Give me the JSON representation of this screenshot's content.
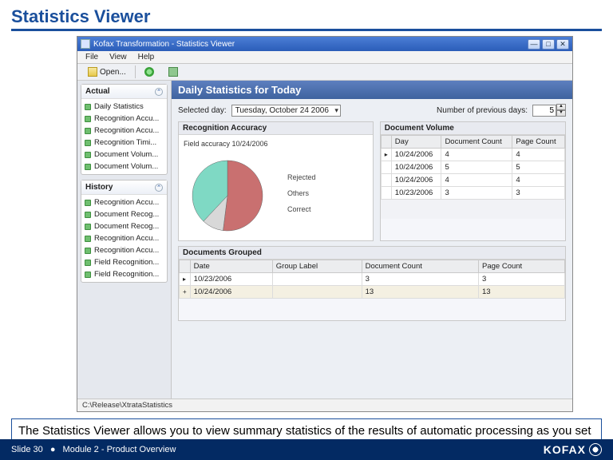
{
  "slide": {
    "title": "Statistics Viewer",
    "caption": "The Statistics Viewer allows you to view summary statistics of the results of automatic processing as you set up and modify your projects.",
    "footer_slide": "Slide 30",
    "footer_module": "Module 2 - Product Overview",
    "brand": "KOFAX"
  },
  "window": {
    "title": "Kofax Transformation - Statistics Viewer",
    "menu": {
      "file": "File",
      "view": "View",
      "help": "Help"
    },
    "toolbar": {
      "open": "Open..."
    },
    "status": "C:\\Release\\XtrataStatistics"
  },
  "sidebar": {
    "actual_title": "Actual",
    "actual": [
      "Daily Statistics",
      "Recognition Accu...",
      "Recognition Accu...",
      "Recognition Timi...",
      "Document Volum...",
      "Document Volum..."
    ],
    "history_title": "History",
    "history": [
      "Recognition Accu...",
      "Document Recog...",
      "Document Recog...",
      "Recognition Accu...",
      "Recognition Accu...",
      "Field Recognition...",
      "Field Recognition..."
    ]
  },
  "main": {
    "heading": "Daily Statistics for Today",
    "selected_label": "Selected day:",
    "selected_value": "Tuesday, October 24 2006",
    "prevdays_label": "Number of previous days:",
    "prevdays_value": "5"
  },
  "recognition": {
    "title": "Recognition Accuracy",
    "chart_caption": "Field accuracy 10/24/2006",
    "legend": {
      "rejected": "Rejected",
      "others": "Others",
      "correct": "Correct"
    }
  },
  "docvol": {
    "title": "Document Volume",
    "cols": {
      "day": "Day",
      "dc": "Document Count",
      "pc": "Page Count"
    },
    "rows": [
      {
        "day": "10/24/2006",
        "dc": "4",
        "pc": "4"
      },
      {
        "day": "10/24/2006",
        "dc": "5",
        "pc": "5"
      },
      {
        "day": "10/24/2006",
        "dc": "4",
        "pc": "4"
      },
      {
        "day": "10/23/2006",
        "dc": "3",
        "pc": "3"
      }
    ]
  },
  "grouped": {
    "title": "Documents Grouped",
    "cols": {
      "date": "Date",
      "gl": "Group Label",
      "dc": "Document Count",
      "pc": "Page Count"
    },
    "rows": [
      {
        "date": "10/23/2006",
        "gl": "",
        "dc": "3",
        "pc": "3"
      },
      {
        "date": "10/24/2006",
        "gl": "",
        "dc": "13",
        "pc": "13"
      }
    ]
  },
  "chart_data": {
    "type": "pie",
    "title": "Field accuracy 10/24/2006",
    "series": [
      {
        "name": "Rejected",
        "value": 52,
        "color": "#c97070"
      },
      {
        "name": "Others",
        "value": 10,
        "color": "#d8d8d8"
      },
      {
        "name": "Correct",
        "value": 38,
        "color": "#7fd9c4"
      }
    ]
  }
}
